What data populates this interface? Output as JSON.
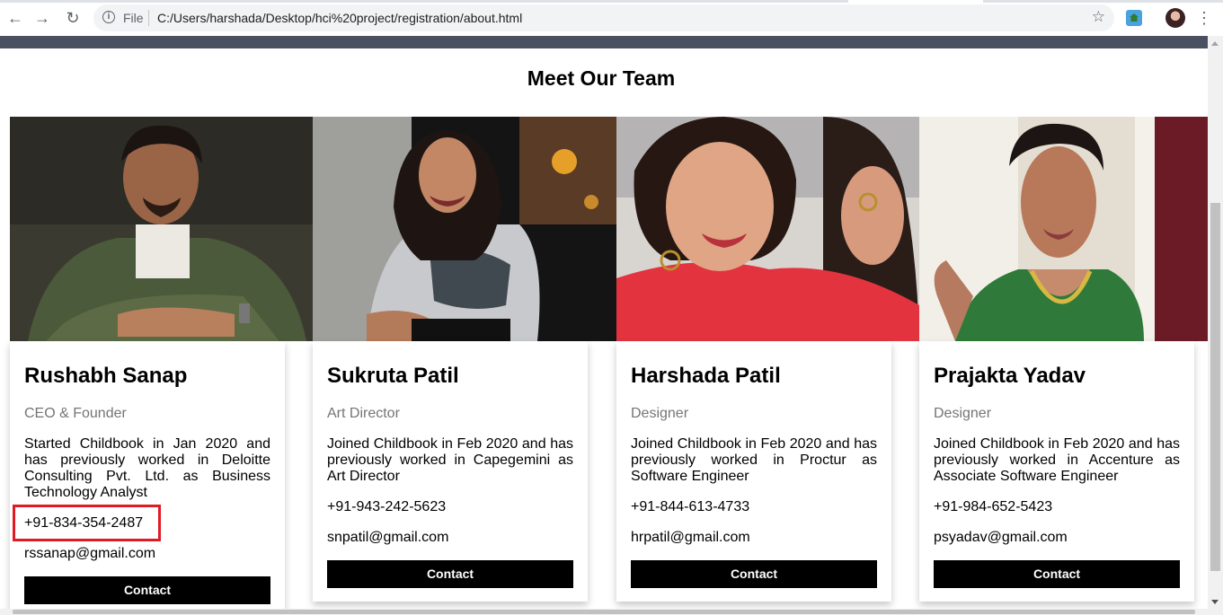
{
  "browser": {
    "file_label": "File",
    "url": "C:/Users/harshada/Desktop/hci%20project/registration/about.html",
    "back_icon": "←",
    "forward_icon": "→",
    "reload_icon": "↻",
    "info_icon": "i",
    "star_icon": "☆",
    "menu_icon": "⋮"
  },
  "page": {
    "heading": "Meet Our Team"
  },
  "team": [
    {
      "name": "Rushabh Sanap",
      "role": "CEO & Founder",
      "bio": "Started Childbook in Jan 2020 and has previously worked in Deloitte Consulting Pvt. Ltd. as Business Technology Analyst",
      "phone": "+91-834-354-2487",
      "email": "rssanap@gmail.com",
      "button": "Contact"
    },
    {
      "name": "Sukruta Patil",
      "role": "Art Director",
      "bio": "Joined Childbook in Feb 2020 and has previously worked in Capegemini as Art Director",
      "phone": "+91-943-242-5623",
      "email": "snpatil@gmail.com",
      "button": "Contact"
    },
    {
      "name": "Harshada Patil",
      "role": "Designer",
      "bio": "Joined Childbook in Feb 2020 and has previously worked in Proctur as Software Engineer",
      "phone": "+91-844-613-4733",
      "email": "hrpatil@gmail.com",
      "button": "Contact"
    },
    {
      "name": "Prajakta Yadav",
      "role": "Designer",
      "bio": "Joined Childbook in Feb 2020 and has previously worked in Accenture as Associate Software Engineer",
      "phone": "+91-984-652-5423",
      "email": "psyadav@gmail.com",
      "button": "Contact"
    }
  ]
}
